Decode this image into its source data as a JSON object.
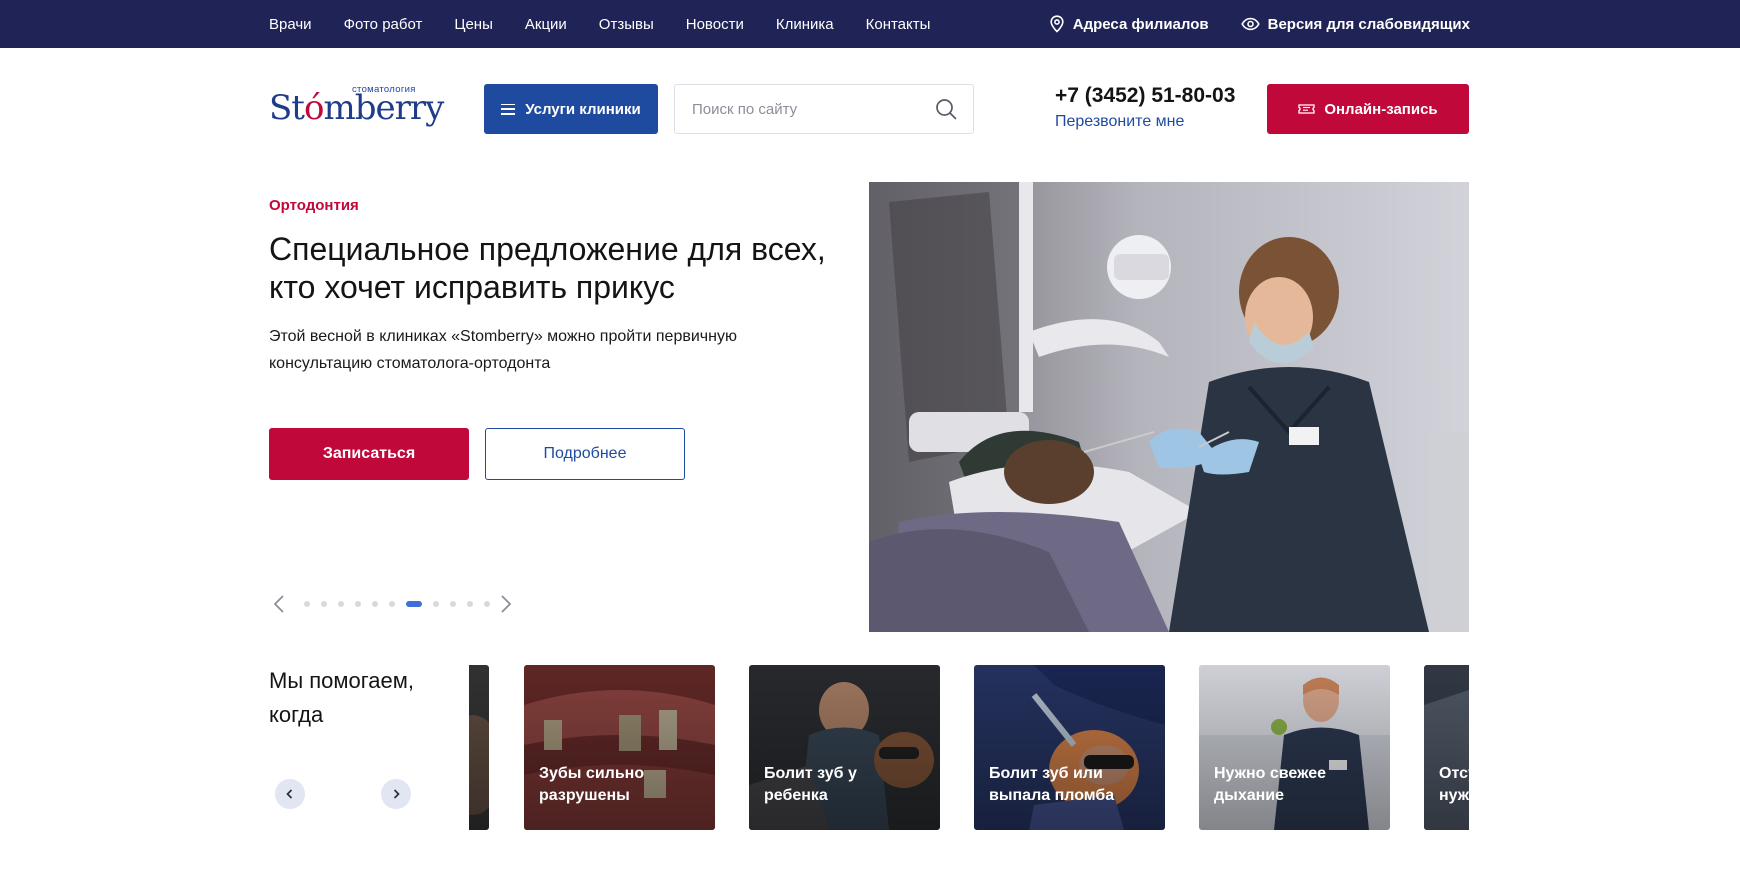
{
  "colors": {
    "topbar_bg": "#1f2356",
    "accent_red": "#c0083a",
    "accent_blue": "#1e4ba0",
    "active_dot": "#3f6fd8"
  },
  "topbar": {
    "nav": [
      "Врачи",
      "Фото работ",
      "Цены",
      "Акции",
      "Отзывы",
      "Новости",
      "Клиника",
      "Контакты"
    ],
    "branches_label": "Адреса филиалов",
    "branches_icon": "location-pin-icon",
    "accessibility_label": "Версия для слабовидящих",
    "accessibility_icon": "eye-icon"
  },
  "header": {
    "logo_sub": "стоматология",
    "logo_text_a": "St",
    "logo_text_accent": "ó",
    "logo_text_b": "mberry",
    "services_label": "Услуги клиники",
    "search_placeholder": "Поиск по сайту",
    "search_icon": "search-icon",
    "phone": "+7 (3452) 51-80-03",
    "callback_label": "Перезвоните мне",
    "online_label": "Онлайн-запись",
    "online_icon": "ticket-icon"
  },
  "hero": {
    "category": "Ортодонтия",
    "title": "Специальное предложение для всех, кто хочет исправить прикус",
    "description": "Этой весной в клиниках «Stomberry» можно пройти первичную консультацию стоматолога-ортодонта",
    "primary_label": "Записаться",
    "secondary_label": "Подробнее",
    "slides_total": 11,
    "active_slide": 7
  },
  "help": {
    "title": "Мы помогаем, когда",
    "cards": [
      {
        "label": ""
      },
      {
        "label": "Зубы сильно разрушены"
      },
      {
        "label": "Болит зуб у ребенка"
      },
      {
        "label": "Болит зуб или выпала пломба"
      },
      {
        "label": "Нужно свежее дыхание"
      },
      {
        "label": "Отсутствуют зубы, нужна имплантация"
      }
    ]
  }
}
